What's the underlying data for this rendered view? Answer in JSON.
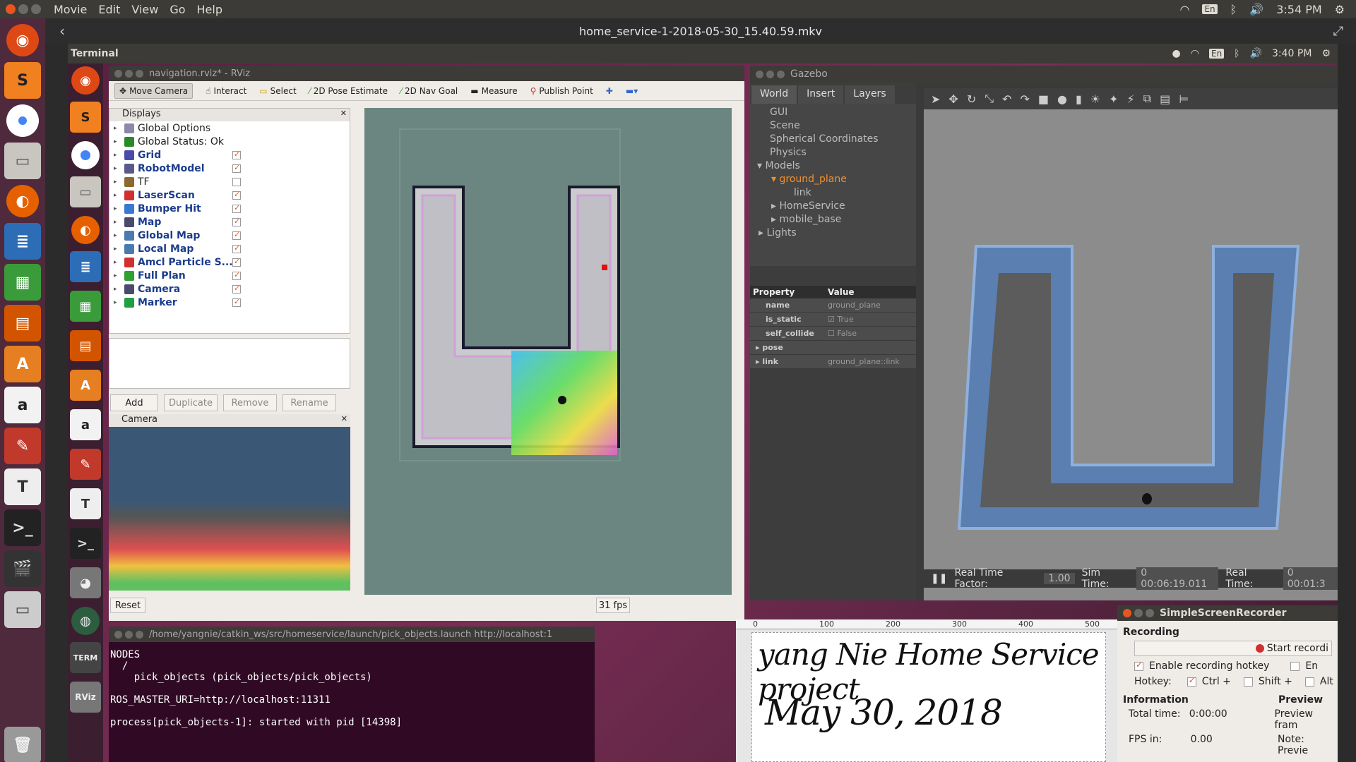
{
  "player": {
    "menu": [
      "Movie",
      "Edit",
      "View",
      "Go",
      "Help"
    ],
    "time": "3:54 PM",
    "lang": "En",
    "file_title": "home_service-1-2018-05-30_15.40.59.mkv"
  },
  "inner_panel": {
    "app_label": "Terminal",
    "time": "3:40 PM",
    "lang": "En"
  },
  "rviz": {
    "title": "navigation.rviz* - RViz",
    "toolbar": [
      "Move Camera",
      "Interact",
      "Select",
      "2D Pose Estimate",
      "2D Nav Goal",
      "Measure",
      "Publish Point"
    ],
    "displays_title": "Displays",
    "displays": [
      {
        "label": "Global Options",
        "checked": null,
        "plain": true
      },
      {
        "label": "Global Status: Ok",
        "checked": null,
        "plain": true
      },
      {
        "label": "Grid",
        "checked": true
      },
      {
        "label": "RobotModel",
        "checked": true
      },
      {
        "label": "TF",
        "checked": false,
        "plain": true
      },
      {
        "label": "LaserScan",
        "checked": true
      },
      {
        "label": "Bumper Hit",
        "checked": true
      },
      {
        "label": "Map",
        "checked": true
      },
      {
        "label": "Global Map",
        "checked": true
      },
      {
        "label": "Local Map",
        "checked": true
      },
      {
        "label": "Amcl Particle S...",
        "checked": true
      },
      {
        "label": "Full Plan",
        "checked": true
      },
      {
        "label": "Camera",
        "checked": true
      },
      {
        "label": "Marker",
        "checked": true
      }
    ],
    "buttons": {
      "add": "Add",
      "duplicate": "Duplicate",
      "remove": "Remove",
      "rename": "Rename"
    },
    "camera_title": "Camera",
    "reset": "Reset",
    "fps": "31 fps"
  },
  "gazebo": {
    "title": "Gazebo",
    "tabs": [
      "World",
      "Insert",
      "Layers"
    ],
    "tree": [
      "GUI",
      "Scene",
      "Spherical Coordinates",
      "Physics",
      "Models",
      "ground_plane",
      "link",
      "HomeService",
      "mobile_base",
      "Lights"
    ],
    "prop_header": {
      "property": "Property",
      "value": "Value"
    },
    "props": [
      {
        "k": "name",
        "v": "ground_plane"
      },
      {
        "k": "is_static",
        "v": "True"
      },
      {
        "k": "self_collide",
        "v": "False"
      },
      {
        "k": "pose",
        "v": ""
      },
      {
        "k": "link",
        "v": "ground_plane::link"
      }
    ],
    "status": {
      "rtf_label": "Real Time Factor:",
      "rtf": "1.00",
      "sim_label": "Sim Time:",
      "sim": "0 00:06:19.011",
      "real_label": "Real Time:",
      "real": "0 00:01:3"
    }
  },
  "terminal": {
    "title": "/home/yangnie/catkin_ws/src/homeservice/launch/pick_objects.launch http://localhost:1",
    "lines": "NODES\n  /\n    pick_objects (pick_objects/pick_objects)\n\nROS_MASTER_URI=http://localhost:11311\n\nprocess[pick_objects-1]: started with pid [14398]"
  },
  "editor": {
    "ruler": [
      "0",
      "100",
      "200",
      "300",
      "400",
      "500"
    ],
    "line1": "yang Nie Home Service project",
    "line2": "May 30, 2018"
  },
  "ssr": {
    "title": "SimpleScreenRecorder",
    "recording": "Recording",
    "start": "Start recordi",
    "enable_hotkey": "Enable recording hotkey",
    "hotkey_label": "Hotkey:",
    "ctrl": "Ctrl +",
    "shift": "Shift +",
    "alt": "Alt",
    "en": "En",
    "information": "Information",
    "preview": "Preview",
    "total_time_label": "Total time:",
    "total_time": "0:00:00",
    "fps_label": "FPS in:",
    "fps": "0.00",
    "preview_frame": "Preview fram",
    "note": "Note: Previe"
  }
}
